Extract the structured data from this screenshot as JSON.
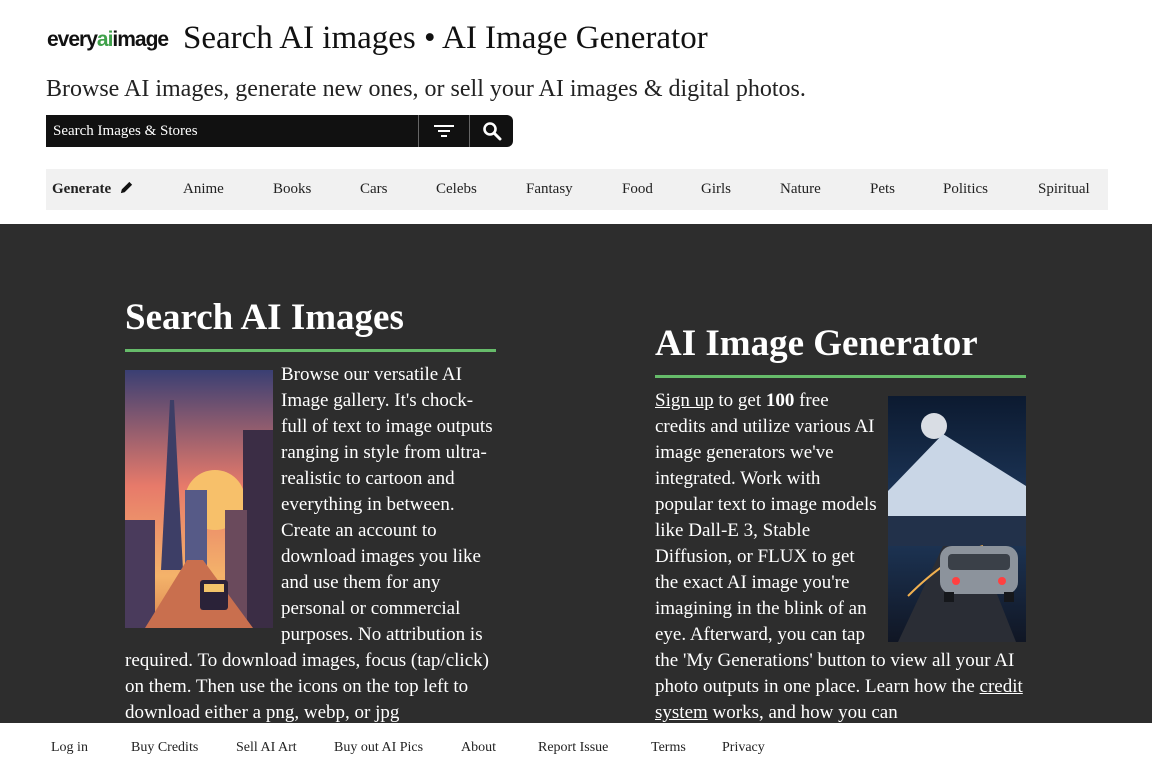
{
  "header": {
    "logo": {
      "part1": "every",
      "part2": "ai",
      "part3": "image"
    },
    "title": "Search AI images • AI Image Generator",
    "tagline": "Browse AI images, generate new ones, or sell your AI images & digital photos."
  },
  "search": {
    "placeholder": "Search Images & Stores",
    "value": "",
    "filter_icon": "filter-icon",
    "search_icon": "search-icon"
  },
  "nav": {
    "generate_label": "Generate",
    "generate_icon": "pencil-icon",
    "items": [
      "Anime",
      "Books",
      "Cars",
      "Celebs",
      "Fantasy",
      "Food",
      "Girls",
      "Nature",
      "Pets",
      "Politics",
      "Spiritual"
    ]
  },
  "left": {
    "heading": "Search AI Images",
    "text": "Browse our versatile AI Image gallery. It's chock-full of text to image outputs ranging in style from ultra-realistic to cartoon and everything in between. Create an account to download images you like and use them for any personal or commercial purposes. No attribution is required. To download images, focus (tap/click) on them. Then use the icons on the top left to download either a png, webp, or jpg"
  },
  "right": {
    "heading": "AI Image Generator",
    "signup_link": "Sign up",
    "text_a": " to get ",
    "credits_amount": "100",
    "text_b": " free credits and utilize various AI image generators we've integrated. Work with popular text to image models like Dall-E 3, Stable Diffusion, or FLUX to get the exact AI image you're imagining in the blink of an eye. Afterward, you can tap the 'My Generations' button to view all your AI photo outputs in one place. Learn how the ",
    "credit_link": "credit system",
    "text_c": " works, and how you can"
  },
  "footer": {
    "links": [
      "Log in",
      "Buy Credits",
      "Sell AI Art",
      "Buy out AI Pics",
      "About",
      "Report Issue",
      "Terms",
      "Privacy"
    ]
  },
  "colors": {
    "accent": "#66bb6a",
    "dark_bg": "#2d2d2d",
    "search_bg": "#111111",
    "nav_bg": "#f1f1f1"
  }
}
